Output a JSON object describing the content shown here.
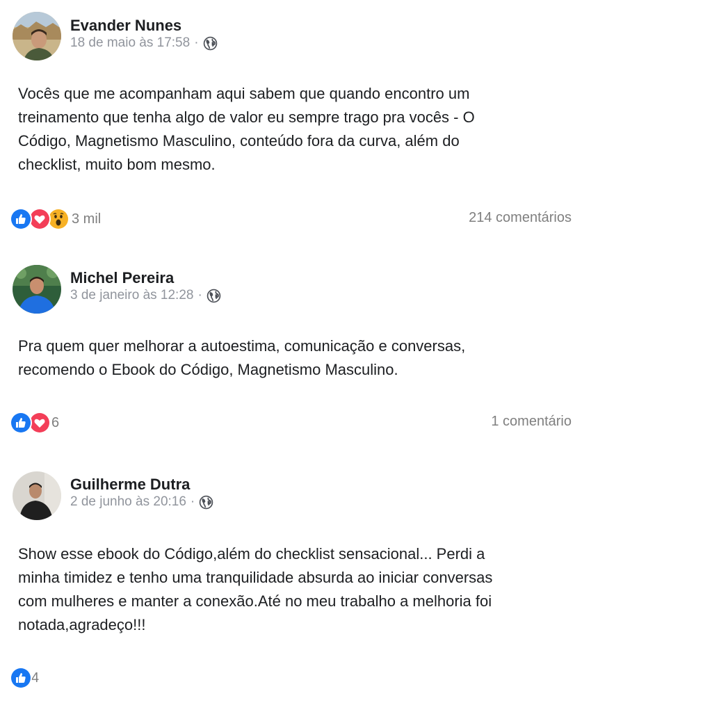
{
  "posts": [
    {
      "author": "Evander Nunes",
      "date": "18 de maio às 17:58",
      "separator": "·",
      "privacy_icon": "globe-icon",
      "text": "Vocês que me acompanham aqui sabem que quando encontro um\ntreinamento que tenha algo de valor eu sempre trago pra vocês - O\nCódigo, Magnetismo Masculino, conteúdo fora da curva, além do\nchecklist, muito bom mesmo.",
      "reaction_icons": [
        "like-icon",
        "love-icon",
        "wow-icon"
      ],
      "reaction_count": "3 mil",
      "comments": "214 comentários"
    },
    {
      "author": "Michel Pereira",
      "date": "3 de janeiro às 12:28",
      "separator": "·",
      "privacy_icon": "globe-icon",
      "text": "Pra quem quer melhorar a autoestima, comunicação e conversas,\nrecomendo o Ebook do Código, Magnetismo Masculino.",
      "reaction_icons": [
        "like-icon",
        "love-icon"
      ],
      "reaction_count": "6",
      "comments": "1 comentário"
    },
    {
      "author": "Guilherme Dutra",
      "date": "2 de junho às 20:16",
      "separator": "·",
      "privacy_icon": "globe-icon",
      "text": "Show esse ebook do Código,além do checklist sensacional... Perdi a\nminha timidez e tenho uma tranquilidade absurda ao iniciar conversas\ncom mulheres e manter a conexão.Até no meu trabalho a melhoria foi\nnotada,agradeço!!!",
      "reaction_icons": [
        "like-icon"
      ],
      "reaction_count": "4",
      "comments": ""
    }
  ],
  "colors": {
    "like": "#1877f2",
    "love": "#f33e58",
    "wow": "#f7b125",
    "meta_text": "#90949c",
    "count_text": "#7f7f7f"
  }
}
